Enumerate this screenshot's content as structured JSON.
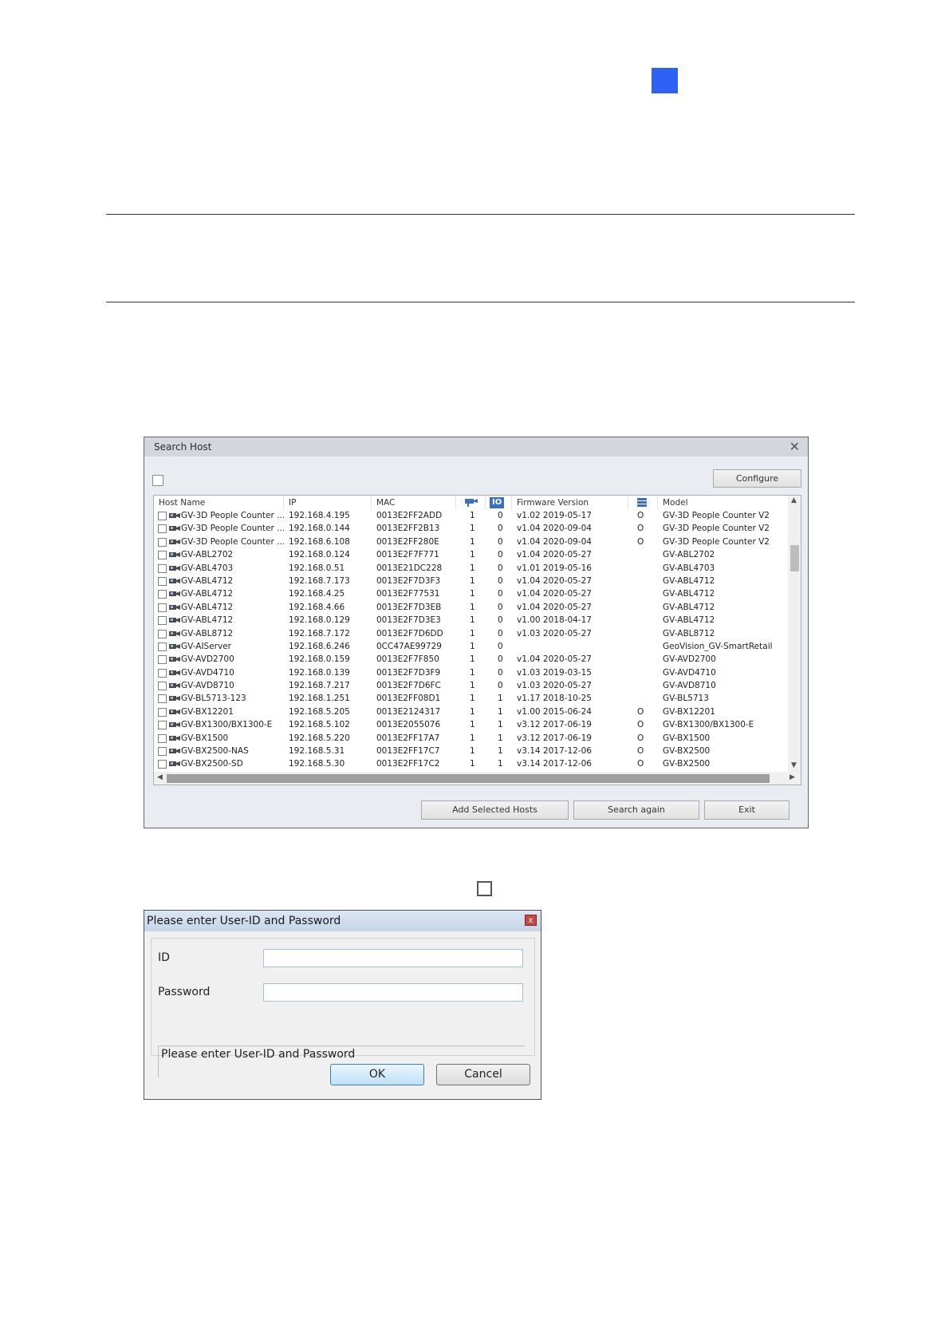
{
  "colors": {
    "accent_square": "#2e62f5"
  },
  "search_host": {
    "title": "Search Host",
    "configure_label": "Configure",
    "columns": [
      "Host Name",
      "IP",
      "MAC",
      "",
      "IO",
      "Firmware Version",
      "",
      "Model"
    ],
    "column_icons": [
      "",
      "",
      "",
      "camera-icon",
      "io-icon",
      "",
      "storage-icon",
      ""
    ],
    "rows": [
      [
        "GV-3D People Counter ...",
        "192.168.4.195",
        "0013E2FF2ADD",
        "1",
        "0",
        "v1.02 2019-05-17",
        "O",
        "GV-3D People Counter V2"
      ],
      [
        "GV-3D People Counter ...",
        "192.168.0.144",
        "0013E2FF2B13",
        "1",
        "0",
        "v1.04 2020-09-04",
        "O",
        "GV-3D People Counter V2"
      ],
      [
        "GV-3D People Counter ...",
        "192.168.6.108",
        "0013E2FF280E",
        "1",
        "0",
        "v1.04 2020-09-04",
        "O",
        "GV-3D People Counter V2"
      ],
      [
        "GV-ABL2702",
        "192.168.0.124",
        "0013E2F7F771",
        "1",
        "0",
        "v1.04 2020-05-27",
        "",
        "GV-ABL2702"
      ],
      [
        "GV-ABL4703",
        "192.168.0.51",
        "0013E21DC228",
        "1",
        "0",
        "v1.01 2019-05-16",
        "",
        "GV-ABL4703"
      ],
      [
        "GV-ABL4712",
        "192.168.7.173",
        "0013E2F7D3F3",
        "1",
        "0",
        "v1.04 2020-05-27",
        "",
        "GV-ABL4712"
      ],
      [
        "GV-ABL4712",
        "192.168.4.25",
        "0013E2F77531",
        "1",
        "0",
        "v1.04 2020-05-27",
        "",
        "GV-ABL4712"
      ],
      [
        "GV-ABL4712",
        "192.168.4.66",
        "0013E2F7D3EB",
        "1",
        "0",
        "v1.04 2020-05-27",
        "",
        "GV-ABL4712"
      ],
      [
        "GV-ABL4712",
        "192.168.0.129",
        "0013E2F7D3E3",
        "1",
        "0",
        "v1.00 2018-04-17",
        "",
        "GV-ABL4712"
      ],
      [
        "GV-ABL8712",
        "192.168.7.172",
        "0013E2F7D6DD",
        "1",
        "0",
        "v1.03 2020-05-27",
        "",
        "GV-ABL8712"
      ],
      [
        "GV-AIServer",
        "192.168.6.246",
        "0CC47AE99729",
        "1",
        "0",
        "",
        "",
        "GeoVision_GV-SmartRetail"
      ],
      [
        "GV-AVD2700",
        "192.168.0.159",
        "0013E2F7F850",
        "1",
        "0",
        "v1.04 2020-05-27",
        "",
        "GV-AVD2700"
      ],
      [
        "GV-AVD4710",
        "192.168.0.139",
        "0013E2F7D3F9",
        "1",
        "0",
        "v1.03 2019-03-15",
        "",
        "GV-AVD4710"
      ],
      [
        "GV-AVD8710",
        "192.168.7.217",
        "0013E2F7D6FC",
        "1",
        "0",
        "v1.03 2020-05-27",
        "",
        "GV-AVD8710"
      ],
      [
        "GV-BL5713-123",
        "192.168.1.251",
        "0013E2FF08D1",
        "1",
        "1",
        "v1.17 2018-10-25",
        "",
        "GV-BL5713"
      ],
      [
        "GV-BX12201",
        "192.168.5.205",
        "0013E2124317",
        "1",
        "1",
        "v1.00 2015-06-24",
        "O",
        "GV-BX12201"
      ],
      [
        "GV-BX1300/BX1300-E",
        "192.168.5.102",
        "0013E2055076",
        "1",
        "1",
        "v3.12 2017-06-19",
        "O",
        "GV-BX1300/BX1300-E"
      ],
      [
        "GV-BX1500",
        "192.168.5.220",
        "0013E2FF17A7",
        "1",
        "1",
        "v3.12 2017-06-19",
        "O",
        "GV-BX1500"
      ],
      [
        "GV-BX2500-NAS",
        "192.168.5.31",
        "0013E2FF17C7",
        "1",
        "1",
        "v3.14 2017-12-06",
        "O",
        "GV-BX2500"
      ],
      [
        "GV-BX2500-SD",
        "192.168.5.30",
        "0013E2FF17C2",
        "1",
        "1",
        "v3.14 2017-12-06",
        "O",
        "GV-BX2500"
      ]
    ],
    "add_label": "Add Selected Hosts",
    "search_again_label": "Search again",
    "exit_label": "Exit"
  },
  "login": {
    "title": "Please enter User-ID and Password",
    "close_label": "x",
    "id_label": "ID",
    "id_value": "",
    "password_label": "Password",
    "password_value": "",
    "message": "Please enter User-ID and Password",
    "ok_label": "OK",
    "cancel_label": "Cancel"
  }
}
